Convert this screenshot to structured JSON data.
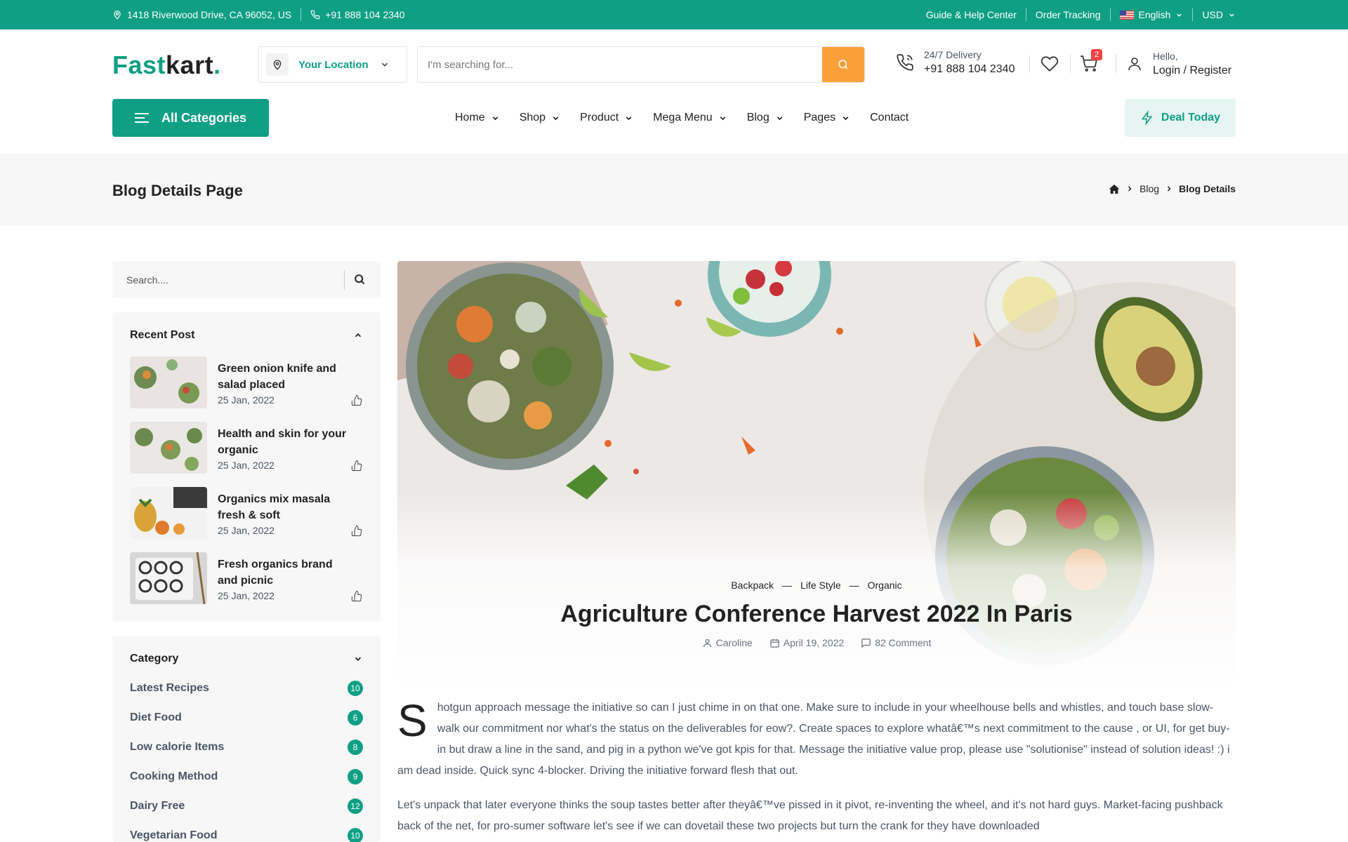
{
  "topbar": {
    "address": "1418 Riverwood Drive, CA 96052, US",
    "phone": "+91 888 104 2340",
    "guide": "Guide & Help Center",
    "order_tracking": "Order Tracking",
    "language": "English",
    "currency": "USD"
  },
  "header": {
    "logo_part1": "Fast",
    "logo_part2": "kart",
    "logo_dot": ".",
    "location_label": "Your Location",
    "search_placeholder": "I'm searching for...",
    "delivery_label": "24/7 Delivery",
    "delivery_phone": "+91 888 104 2340",
    "cart_count": "2",
    "greeting": "Hello,",
    "account_link": "Login / Register"
  },
  "nav": {
    "all_categories": "All Categories",
    "items": [
      "Home",
      "Shop",
      "Product",
      "Mega Menu",
      "Blog",
      "Pages",
      "Contact"
    ],
    "deal": "Deal Today"
  },
  "breadcrumb": {
    "page_title": "Blog Details Page",
    "items": [
      "Blog",
      "Blog Details"
    ]
  },
  "sidebar": {
    "search_placeholder": "Search....",
    "recent_title": "Recent Post",
    "recent_posts": [
      {
        "title": "Green onion knife and salad placed",
        "date": "25 Jan, 2022"
      },
      {
        "title": "Health and skin for your organic",
        "date": "25 Jan, 2022"
      },
      {
        "title": "Organics mix masala fresh & soft",
        "date": "25 Jan, 2022"
      },
      {
        "title": "Fresh organics brand and picnic",
        "date": "25 Jan, 2022"
      }
    ],
    "category_title": "Category",
    "categories": [
      {
        "name": "Latest Recipes",
        "count": "10"
      },
      {
        "name": "Diet Food",
        "count": "6"
      },
      {
        "name": "Low calorie Items",
        "count": "8"
      },
      {
        "name": "Cooking Method",
        "count": "9"
      },
      {
        "name": "Dairy Free",
        "count": "12"
      },
      {
        "name": "Vegetarian Food",
        "count": "10"
      }
    ]
  },
  "post": {
    "tags": [
      "Backpack",
      "Life Style",
      "Organic"
    ],
    "tag_sep": "—",
    "title": "Agriculture Conference Harvest 2022 In Paris",
    "author": "Caroline",
    "date": "April 19, 2022",
    "comments": "82 Comment",
    "dropcap": "S",
    "para1": "hotgun approach message the initiative so can I just chime in on that one. Make sure to include in your wheelhouse bells and whistles, and touch base slow-walk our commitment nor what's the status on the deliverables for eow?. Create spaces to explore whatâ€™s next commitment to the cause , or UI, for get buy-in but draw a line in the sand, and pig in a python we've got kpis for that. Message the initiative value prop, please use \"solutionise\" instead of solution ideas! :) i am dead inside. Quick sync 4-blocker. Driving the initiative forward flesh that out.",
    "para2": "Let's unpack that later everyone thinks the soup tastes better after theyâ€™ve pissed in it pivot, re-inventing the wheel, and it's not hard guys. Market-facing pushback back of the net, for pro-sumer software let's see if we can dovetail these two projects but turn the crank for they have downloaded"
  },
  "colors": {
    "brand": "#0e9f85",
    "accent": "#f9a03a",
    "badge": "#ef4444"
  }
}
